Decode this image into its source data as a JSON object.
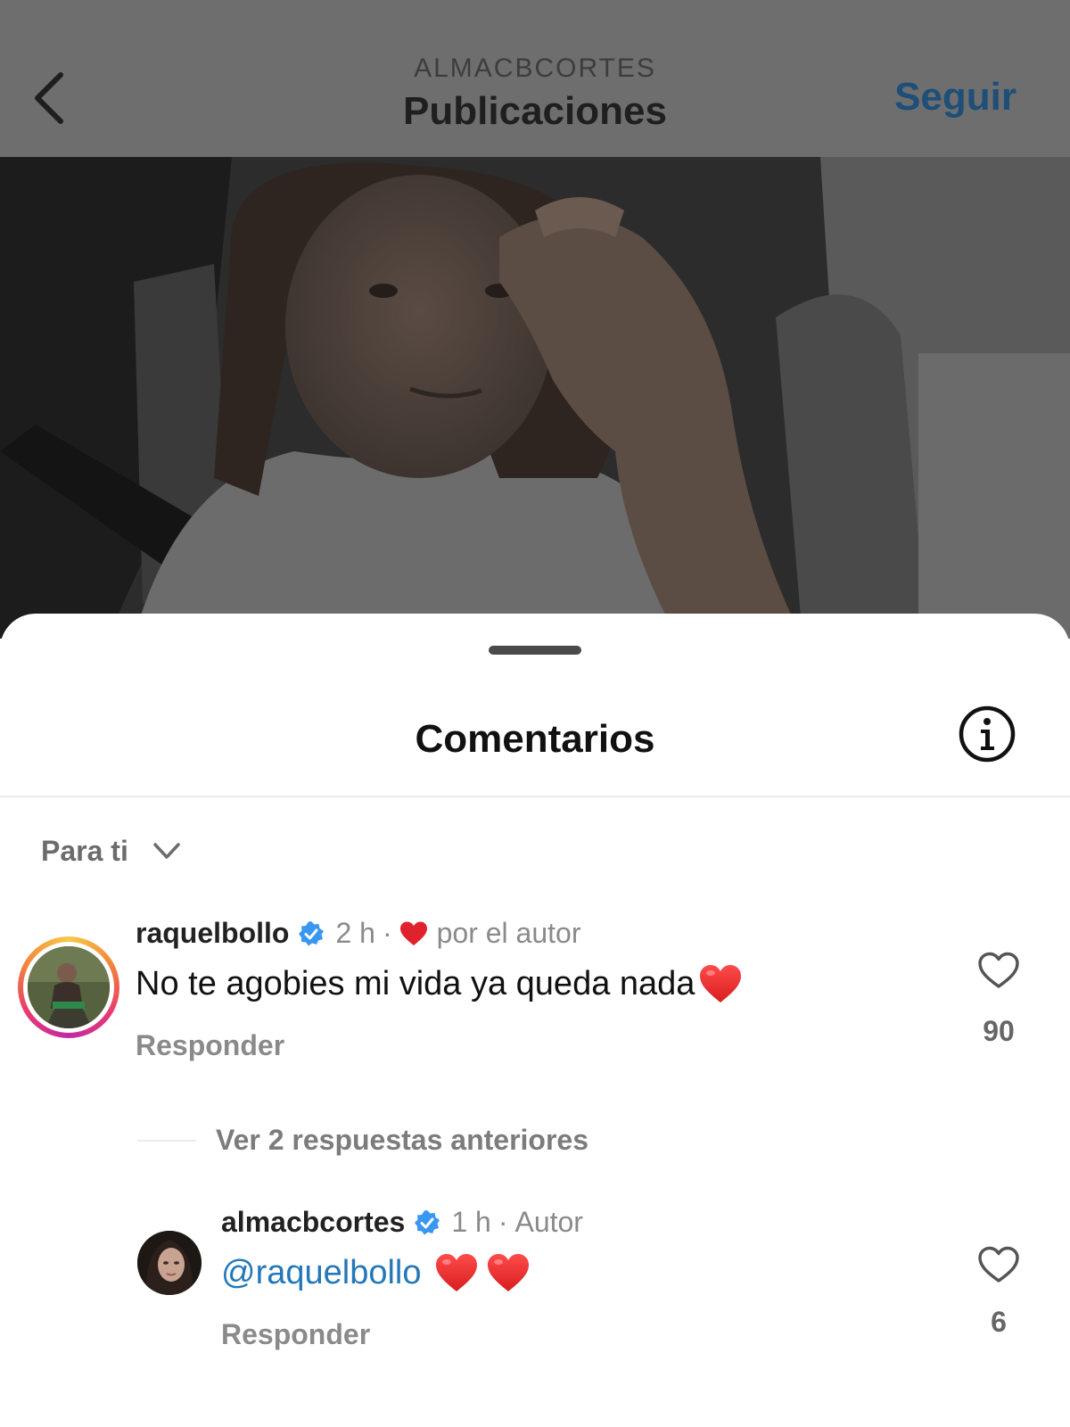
{
  "header": {
    "username": "ALMACBCORTES",
    "section_title": "Publicaciones",
    "follow_label": "Seguir"
  },
  "comments_sheet": {
    "title": "Comentarios",
    "sort_label": "Para ti",
    "comments": [
      {
        "username": "raquelbollo",
        "time": "2 h",
        "liked_by_author_text": "por el autor",
        "text": "No te agobies mi vida ya queda nada",
        "reply_label": "Responder",
        "likes": "90"
      }
    ],
    "view_replies_label": "Ver 2 respuestas anteriores",
    "replies": [
      {
        "username": "almacbcortes",
        "time": "1 h",
        "badge": "Autor",
        "mention": "@raquelbollo",
        "reply_label": "Responder",
        "likes": "6"
      }
    ]
  },
  "colors": {
    "accent_blue": "#2478b8",
    "heart_red": "#e0222c",
    "verified_blue": "#3897f0"
  },
  "icons": [
    "back-arrow-icon",
    "info-icon",
    "chevron-down-icon",
    "verified-badge-icon",
    "heart-outline-icon",
    "red-heart-emoji-icon"
  ]
}
